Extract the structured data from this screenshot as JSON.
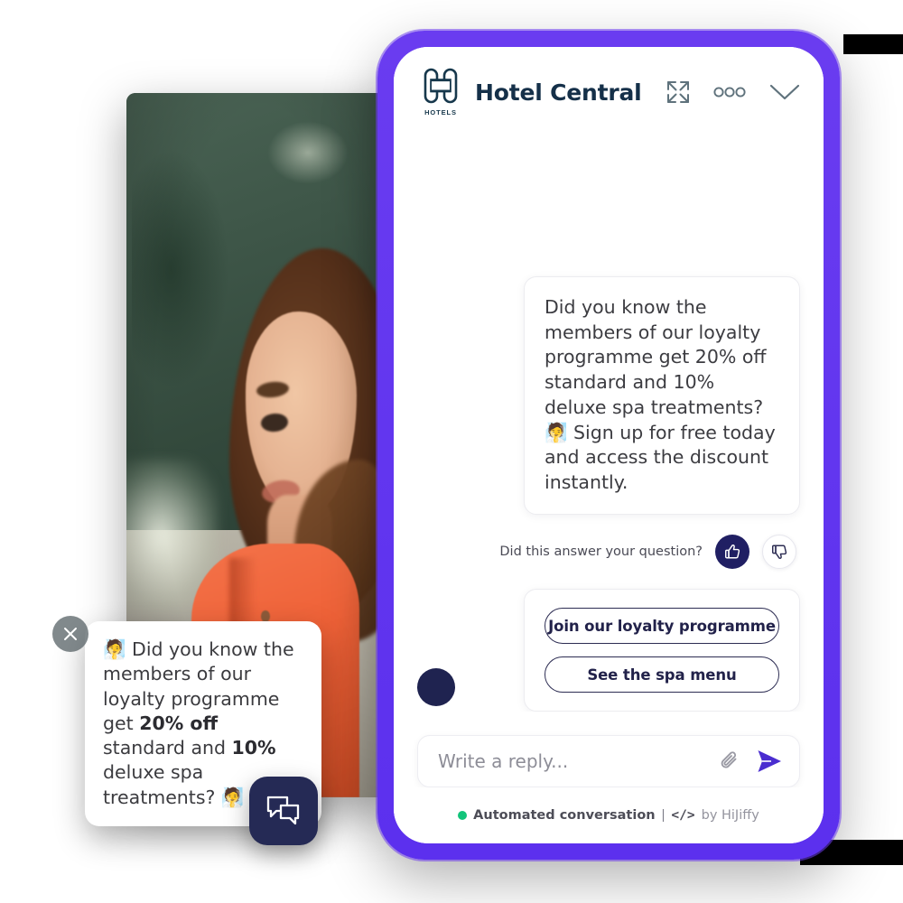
{
  "colors": {
    "phone_border": "#6236ef",
    "brand_navy": "#153049",
    "accent_purple": "#4A2DD0",
    "avatar_navy": "#1f2350",
    "thumbs_up_bg": "#201f63",
    "status_green": "#12c47a",
    "launcher_navy": "#252a55"
  },
  "header": {
    "logo_icon": "hotel-h-logo-icon",
    "logo_caption": "HOTELS",
    "brand_name": "Hotel Central",
    "actions": [
      {
        "icon": "expand-icon",
        "name": "expand-button"
      },
      {
        "icon": "more-horizontal-icon",
        "name": "more-options-button"
      },
      {
        "icon": "chevron-down-icon",
        "name": "minimize-button"
      }
    ]
  },
  "conversation": {
    "bot_message": "Did you know the members of our loyalty programme get 20% off standard and 10% deluxe spa treatments? 🧖 Sign up for free today and access the discount instantly.",
    "feedback": {
      "label": "Did this answer your question?",
      "thumbs_up_icon": "thumbs-up-icon",
      "thumbs_down_icon": "thumbs-down-icon"
    },
    "avatar_icon": "agent-avatar",
    "quick_replies": [
      "Join our loyalty programme",
      "See the spa menu"
    ]
  },
  "composer": {
    "placeholder": "Write a reply...",
    "value": "",
    "attach_icon": "paperclip-icon",
    "send_icon": "send-icon"
  },
  "footer": {
    "status_text": "Automated conversation",
    "separator": "|",
    "code_icon_text": "</>",
    "by_text": "by HiJiffy"
  },
  "notification": {
    "close_icon": "close-icon",
    "text_prefix": "🧖 Did you know the members of our loyalty programme get ",
    "bold_1": "20% off",
    "text_mid": " standard and ",
    "bold_2": "10%",
    "text_suffix": " deluxe spa treatments? 🧖"
  },
  "launcher": {
    "icon": "chat-bubbles-icon"
  }
}
